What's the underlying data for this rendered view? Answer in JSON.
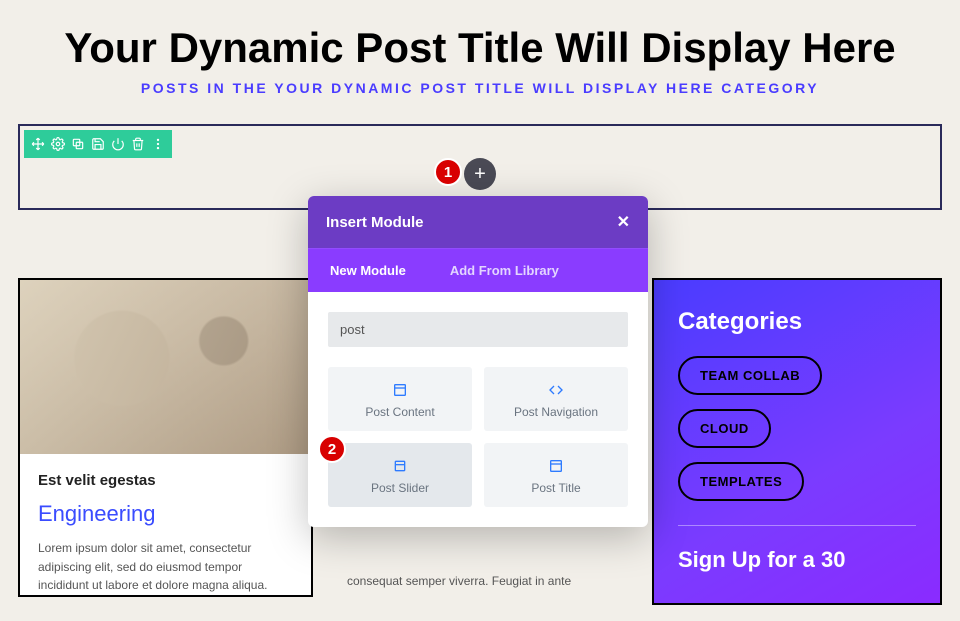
{
  "page": {
    "title": "Your Dynamic Post Title Will Display Here",
    "subtitle": "POSTS IN THE YOUR DYNAMIC POST TITLE WILL DISPLAY HERE CATEGORY"
  },
  "annotations": {
    "badge1": "1",
    "badge2": "2"
  },
  "addButton": "+",
  "modal": {
    "title": "Insert Module",
    "close": "✕",
    "tabs": {
      "new": "New Module",
      "library": "Add From Library"
    },
    "search": "post",
    "modules": {
      "postContent": "Post Content",
      "postNavigation": "Post Navigation",
      "postSlider": "Post Slider",
      "postTitle": "Post Title"
    }
  },
  "leftCard": {
    "title": "Est velit egestas",
    "category": "Engineering",
    "body": "Lorem ipsum dolor sit amet, consectetur adipiscing elit, sed do eiusmod tempor incididunt ut labore et dolore magna aliqua."
  },
  "midSnippet": "consequat semper viverra. Feugiat in ante",
  "sidebar": {
    "heading": "Categories",
    "cat1": "TEAM COLLAB",
    "cat2": "CLOUD",
    "cat3": "TEMPLATES",
    "signup": "Sign Up for a 30"
  }
}
